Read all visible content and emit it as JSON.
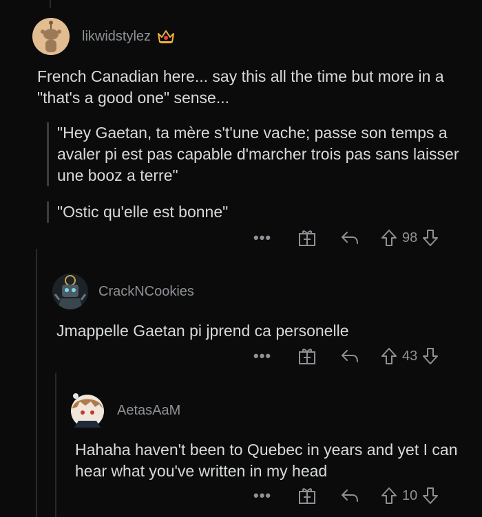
{
  "comments": [
    {
      "username": "likwidstylez",
      "body": "French Canadian here... say this all the time but more in a \"that's a good one\" sense...",
      "quotes": [
        "\"Hey Gaetan, ta mère s't'une vache; passe son temps a avaler pi est pas capable d'marcher trois pas sans laisser une booz a terre\"",
        "\"Ostic qu'elle est bonne\""
      ],
      "more": "•••",
      "votes": "98"
    },
    {
      "username": "CrackNCookies",
      "body": "Jmappelle Gaetan pi jprend ca personelle",
      "more": "•••",
      "votes": "43"
    },
    {
      "username": "AetasAaM",
      "body": "Hahaha haven't been to Quebec in years and yet I can hear what you've written in my head",
      "more": "•••",
      "votes": "10"
    }
  ],
  "colors": {
    "background": "#0b0b0b",
    "text": "#d7dadc",
    "muted": "#8e9296",
    "flair": "#f4b23d"
  }
}
